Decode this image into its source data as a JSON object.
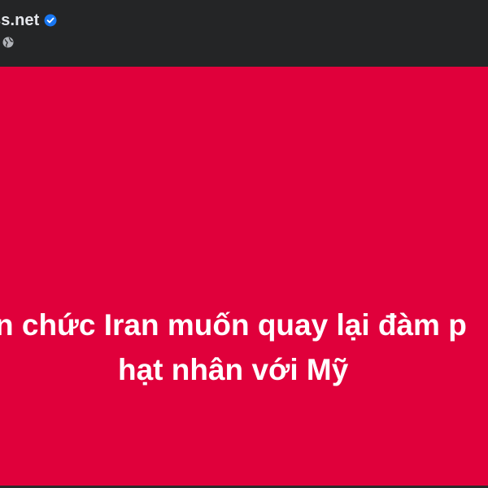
{
  "header": {
    "page_name": "ss.net",
    "verified_icon": "verified-badge-icon",
    "privacy_icon": "globe-icon"
  },
  "image": {
    "background_color": "#e0003b",
    "headline_line_1": "n chức Iran muốn quay lại đàm p",
    "headline_line_2": "hạt nhân với Mỹ"
  }
}
